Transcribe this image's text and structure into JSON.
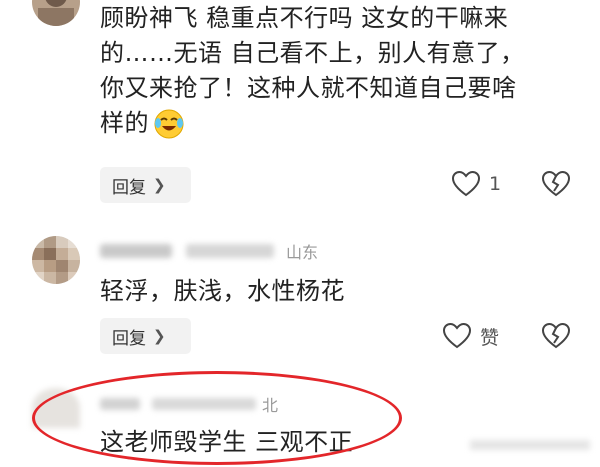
{
  "comments": [
    {
      "text_lines": [
        "顾盼神飞 稳重点不行吗 这女的干嘛来",
        "的……无语 自己看不上，别人有意了，",
        "你又来抢了！这种人就不知道自己要啥",
        "样的"
      ],
      "emoji": "crying-laughing",
      "reply_label": "回复",
      "like_label": "1"
    },
    {
      "username": "",
      "location": "山东",
      "text_lines": [
        "轻浮，肤浅，水性杨花"
      ],
      "reply_label": "回复",
      "like_label": "赞"
    },
    {
      "username": "",
      "location_partial": "北",
      "text_lines": [
        "这老师毁学生 三观不正"
      ]
    }
  ],
  "colors": {
    "highlight_ring": "#e3262a",
    "reply_bg": "#f2f2f2",
    "meta_gray": "#9a9a9a"
  }
}
